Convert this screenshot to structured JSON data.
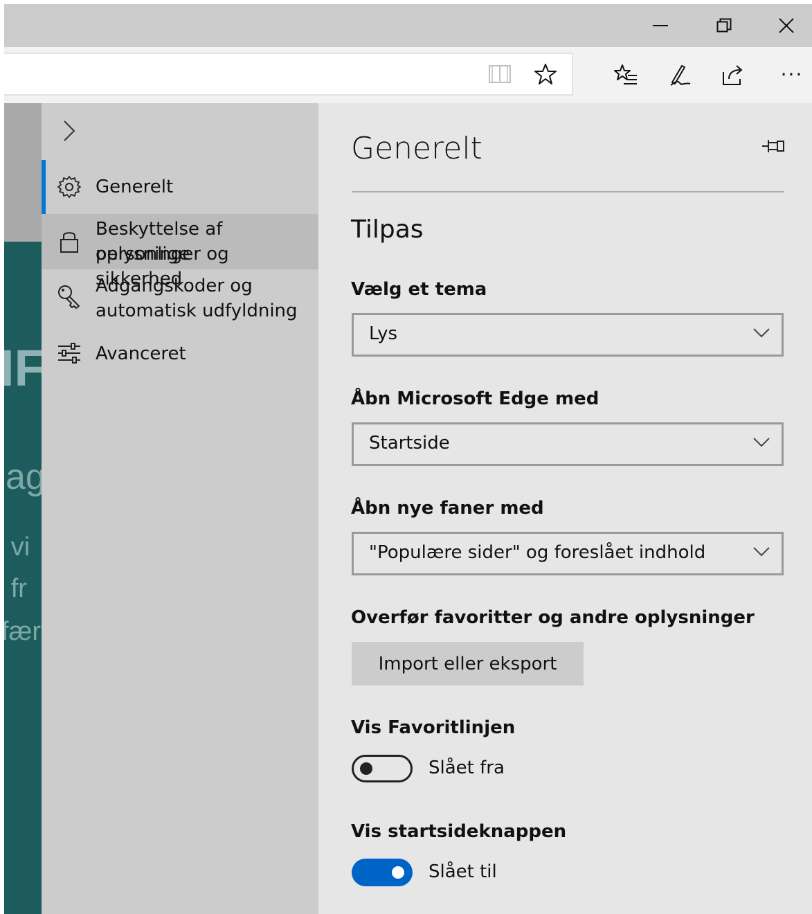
{
  "window_controls": {
    "minimize_icon": "minimize-icon",
    "restore_icon": "restore-icon",
    "close_icon": "close-icon"
  },
  "toolbar": {
    "reading_view_icon": "book-icon",
    "favorite_icon": "star-icon",
    "favorites_hub_icon": "favorites-list-icon",
    "web_note_icon": "pen-icon",
    "share_icon": "share-icon",
    "more_icon": "ellipsis-icon",
    "more_label": "···"
  },
  "background_page": {
    "fragments": [
      "IF",
      "ag",
      "g vi",
      "g fr",
      "fær"
    ]
  },
  "nav": {
    "collapse_glyph": "›",
    "items": [
      {
        "label": "Generelt",
        "icon": "gear-icon",
        "active": true
      },
      {
        "label_line1": "Beskyttelse af personlige",
        "label_line2": "oplysninger og sikkerhed",
        "icon": "lock-icon",
        "hover": true
      },
      {
        "label_line1": "Adgangskoder og",
        "label_line2": "automatisk udfyldning",
        "icon": "key-icon"
      },
      {
        "label": "Avanceret",
        "icon": "sliders-icon"
      }
    ]
  },
  "panel": {
    "title": "Generelt",
    "pin_icon": "pin-icon",
    "section_title": "Tilpas",
    "theme": {
      "label": "Vælg et tema",
      "value": "Lys"
    },
    "open_with": {
      "label": "Åbn Microsoft Edge med",
      "value": "Startside"
    },
    "new_tabs": {
      "label": "Åbn nye faner med",
      "value": "\"Populære sider\" og foreslået indhold"
    },
    "transfer": {
      "label": "Overfør favoritter og andre oplysninger",
      "button": "Import eller eksport"
    },
    "favorites_bar": {
      "label": "Vis Favoritlinjen",
      "state_text": "Slået fra",
      "on": false
    },
    "home_button": {
      "label": "Vis startsideknappen",
      "state_text": "Slået til",
      "on": true
    }
  },
  "colors": {
    "accent": "#0063c6",
    "nav_active_bar": "#0078d7",
    "nav_bg": "#cccccc",
    "panel_bg": "#e6e6e6",
    "page_bg": "#1d5c5c"
  }
}
